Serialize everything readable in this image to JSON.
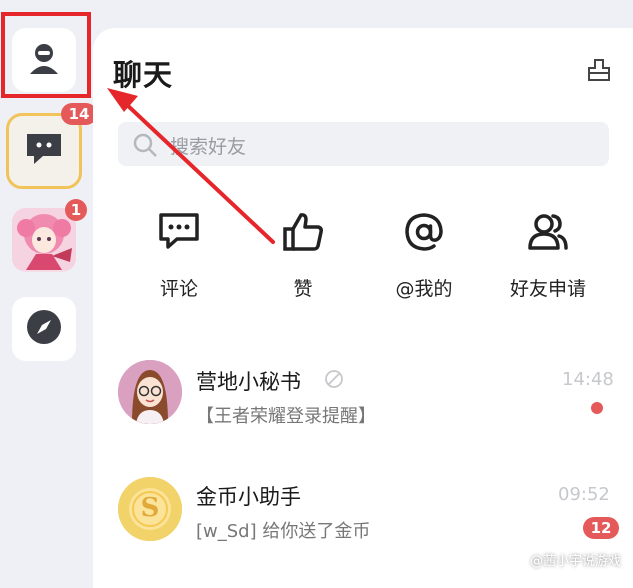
{
  "sidebar": {
    "items": [
      {
        "name": "profile",
        "icon": "user-icon"
      },
      {
        "name": "chat",
        "icon": "chat-bubble-icon",
        "badge": "14"
      },
      {
        "name": "game-avatar",
        "icon": "anime-avatar-icon",
        "badge": "1"
      },
      {
        "name": "discover",
        "icon": "compass-icon"
      }
    ]
  },
  "header": {
    "title": "聊天",
    "action_icon": "clear-icon"
  },
  "search": {
    "placeholder": "搜索好友"
  },
  "quick_actions": [
    {
      "label": "评论",
      "icon": "comment-icon"
    },
    {
      "label": "赞",
      "icon": "thumbs-up-icon"
    },
    {
      "label": "@我的",
      "icon": "at-sign-icon"
    },
    {
      "label": "好友申请",
      "icon": "friends-icon"
    }
  ],
  "chats": [
    {
      "name": "营地小秘书",
      "preview": "【王者荣耀登录提醒】",
      "time": "14:48",
      "unread_dot": true
    },
    {
      "name": "金币小助手",
      "avatar_letter": "S",
      "preview": "[w_Sd] 给你送了金币",
      "time": "09:52",
      "badge": "12"
    }
  ],
  "watermark": "@茜小宇说游戏",
  "colors": {
    "accent_red": "#e5262b",
    "badge_red": "#e45a5a",
    "chat_highlight": "#f1c45b",
    "coin_yellow": "#f1d36a",
    "page_bg": "#eef0f5"
  }
}
